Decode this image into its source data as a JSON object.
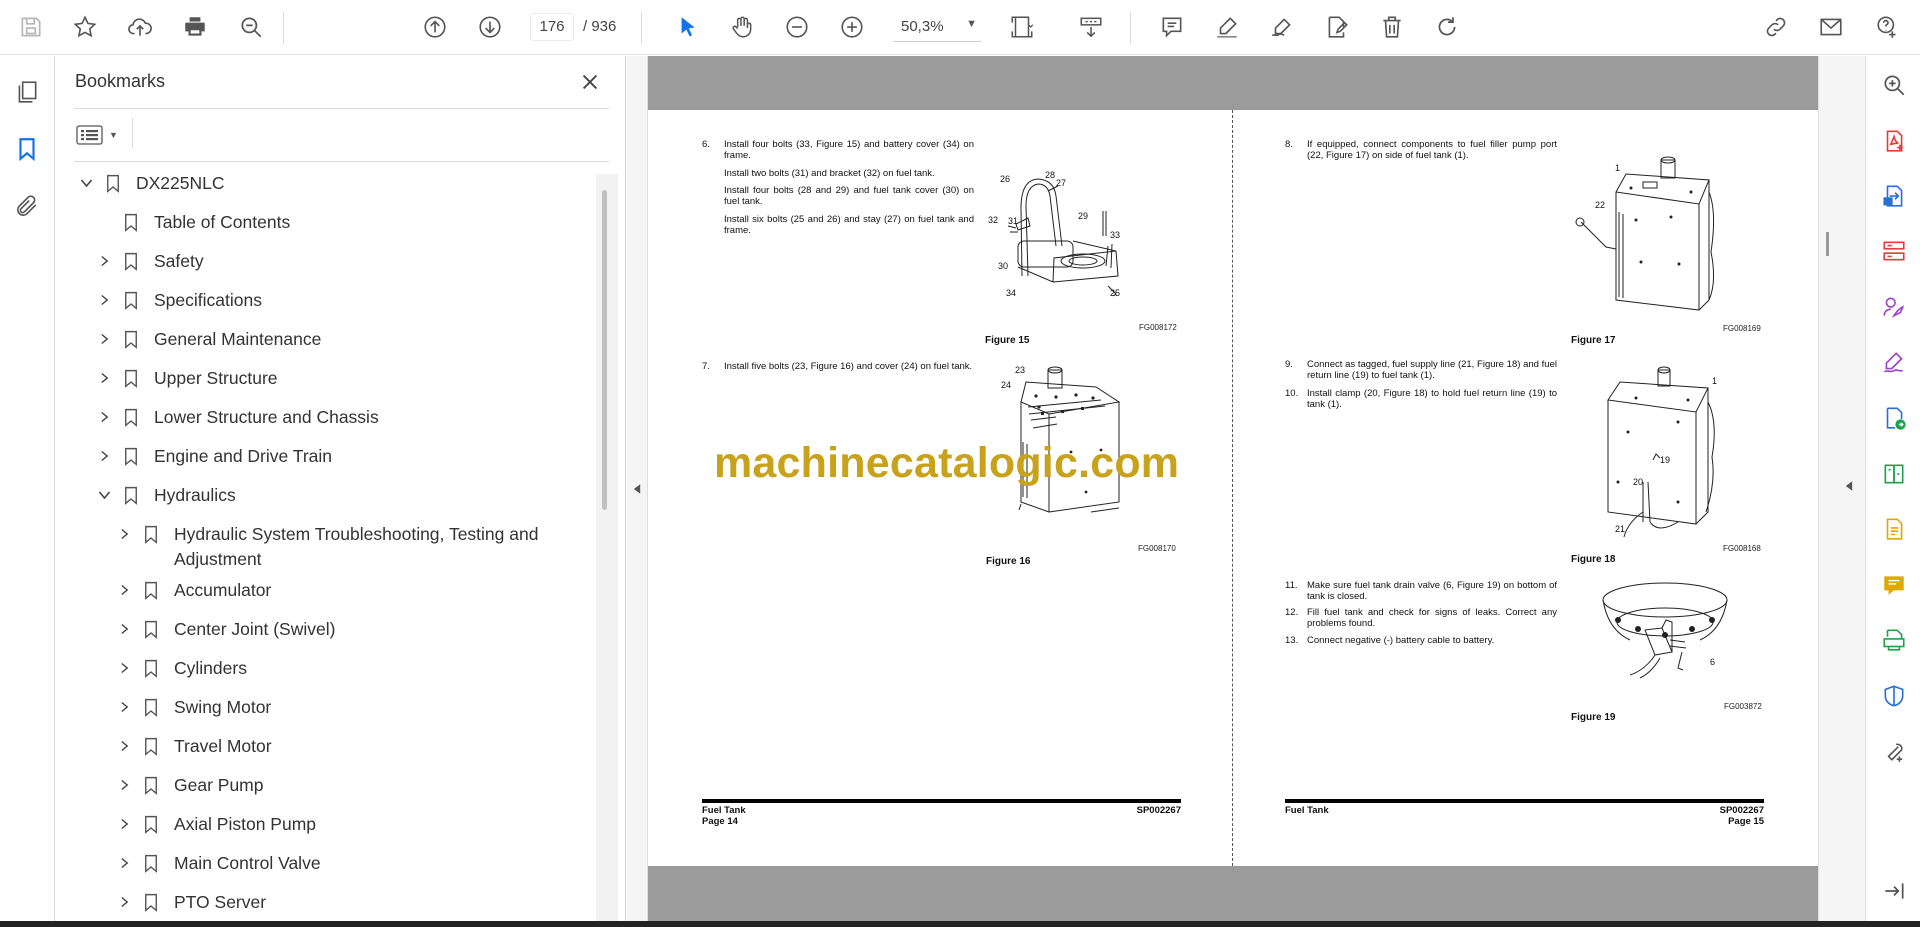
{
  "toolbar": {
    "page_current": "176",
    "page_total": "/  936",
    "zoom": "50,3%",
    "left_icons": [
      "save-icon",
      "star-icon",
      "upload-cloud-icon",
      "print-icon",
      "zoom-search-icon"
    ],
    "nav_icons": [
      "page-up-icon",
      "page-down-icon"
    ],
    "tool_icons": [
      "select-arrow-icon",
      "hand-icon",
      "zoom-out-icon",
      "zoom-in-icon"
    ],
    "edit_icons": [
      "fit-page-icon",
      "scroll-mode-icon",
      "comment-icon",
      "highlight-pen-icon",
      "sign-pen-icon",
      "edit-text-icon",
      "trash-icon",
      "rotate-icon"
    ],
    "right_icons": [
      "share-link-icon",
      "mail-icon",
      "account-help-icon"
    ],
    "accent": "#1473e6"
  },
  "bookmarks": {
    "title": "Bookmarks",
    "items": [
      {
        "label": "DX225NLC",
        "level": 0,
        "expand": "open"
      },
      {
        "label": "Table of Contents",
        "level": 1,
        "expand": "none"
      },
      {
        "label": "Safety",
        "level": 1,
        "expand": "closed"
      },
      {
        "label": "Specifications",
        "level": 1,
        "expand": "closed"
      },
      {
        "label": "General Maintenance",
        "level": 1,
        "expand": "closed"
      },
      {
        "label": "Upper Structure",
        "level": 1,
        "expand": "closed"
      },
      {
        "label": "Lower Structure and Chassis",
        "level": 1,
        "expand": "closed"
      },
      {
        "label": "Engine and Drive Train",
        "level": 1,
        "expand": "closed"
      },
      {
        "label": "Hydraulics",
        "level": 1,
        "expand": "open"
      },
      {
        "label": "Hydraulic System Troubleshooting, Testing and Adjustment",
        "level": 2,
        "expand": "closed"
      },
      {
        "label": "Accumulator",
        "level": 2,
        "expand": "closed"
      },
      {
        "label": "Center Joint (Swivel)",
        "level": 2,
        "expand": "closed"
      },
      {
        "label": "Cylinders",
        "level": 2,
        "expand": "closed"
      },
      {
        "label": "Swing Motor",
        "level": 2,
        "expand": "closed"
      },
      {
        "label": "Travel Motor",
        "level": 2,
        "expand": "closed"
      },
      {
        "label": "Gear Pump",
        "level": 2,
        "expand": "closed"
      },
      {
        "label": "Axial Piston Pump",
        "level": 2,
        "expand": "closed"
      },
      {
        "label": "Main Control Valve",
        "level": 2,
        "expand": "closed"
      },
      {
        "label": "PTO Server",
        "level": 2,
        "expand": "closed"
      }
    ]
  },
  "document": {
    "left_page": {
      "step6": {
        "num": "6.",
        "text": "Install four bolts (33, Figure 15) and battery cover (34) on frame."
      },
      "step6_sub": [
        "Install two bolts (31) and bracket (32) on fuel tank.",
        "Install four bolts (28 and 29) and fuel tank cover (30) on fuel tank.",
        "Install six bolts (25 and 26) and stay (27) on fuel tank and frame."
      ],
      "fig15": {
        "caption": "Figure 15",
        "code": "FG008172",
        "labels": [
          "26",
          "28",
          "27",
          "29",
          "32",
          "31",
          "33",
          "30",
          "34",
          "25"
        ]
      },
      "step7": {
        "num": "7.",
        "text": "Install five bolts (23, Figure 16) and cover (24) on fuel tank."
      },
      "fig16": {
        "caption": "Figure 16",
        "code": "FG008170",
        "labels": [
          "23",
          "24"
        ]
      },
      "footer_left_title": "Fuel Tank",
      "footer_left_page": "Page 14",
      "footer_right": "SP002267"
    },
    "right_page": {
      "step8": {
        "num": "8.",
        "text": "If equipped, connect components to fuel filler pump port (22, Figure 17) on side of fuel tank (1)."
      },
      "fig17": {
        "caption": "Figure 17",
        "code": "FG008169",
        "labels": [
          "1",
          "22"
        ]
      },
      "step9": {
        "num": "9.",
        "text": "Connect as tagged, fuel supply line (21, Figure 18) and fuel return line (19) to fuel tank (1)."
      },
      "step10": {
        "num": "10.",
        "text": "Install clamp (20, Figure 18) to hold fuel return line (19) to tank (1)."
      },
      "fig18": {
        "caption": "Figure 18",
        "code": "FG008168",
        "labels": [
          "1",
          "19",
          "20",
          "21"
        ]
      },
      "step11": {
        "num": "11.",
        "text": "Make sure fuel tank drain valve (6, Figure 19) on bottom of tank is closed."
      },
      "step12": {
        "num": "12.",
        "text": "Fill fuel tank and check for signs of leaks. Correct any problems found."
      },
      "step13": {
        "num": "13.",
        "text": "Connect negative (-) battery cable to battery."
      },
      "fig19": {
        "caption": "Figure 19",
        "code": "FG003872",
        "labels": [
          "6"
        ]
      },
      "footer_left_title": "Fuel Tank",
      "footer_right_code": "SP002267",
      "footer_right_page": "Page 15"
    },
    "watermark": "machinecatalogic.com",
    "watermark_color": "#c9a21b"
  },
  "right_rail": {
    "icons": [
      "zoom-search-icon",
      "create-pdf-icon",
      "export-pdf-icon",
      "organize-pages-icon",
      "request-signature-icon",
      "fill-sign-icon",
      "send-for-review-icon",
      "compare-files-icon",
      "edit-pdf-icon",
      "comment-icon",
      "print-production-icon",
      "protect-shield-icon",
      "more-tools-icon",
      "collapse-panel-icon"
    ],
    "colors": {
      "red": "#e23c3c",
      "blue": "#2a6fd6",
      "purple": "#9a42c8",
      "green": "#22a04b",
      "yellow": "#e0a800",
      "gray": "#555555"
    }
  }
}
